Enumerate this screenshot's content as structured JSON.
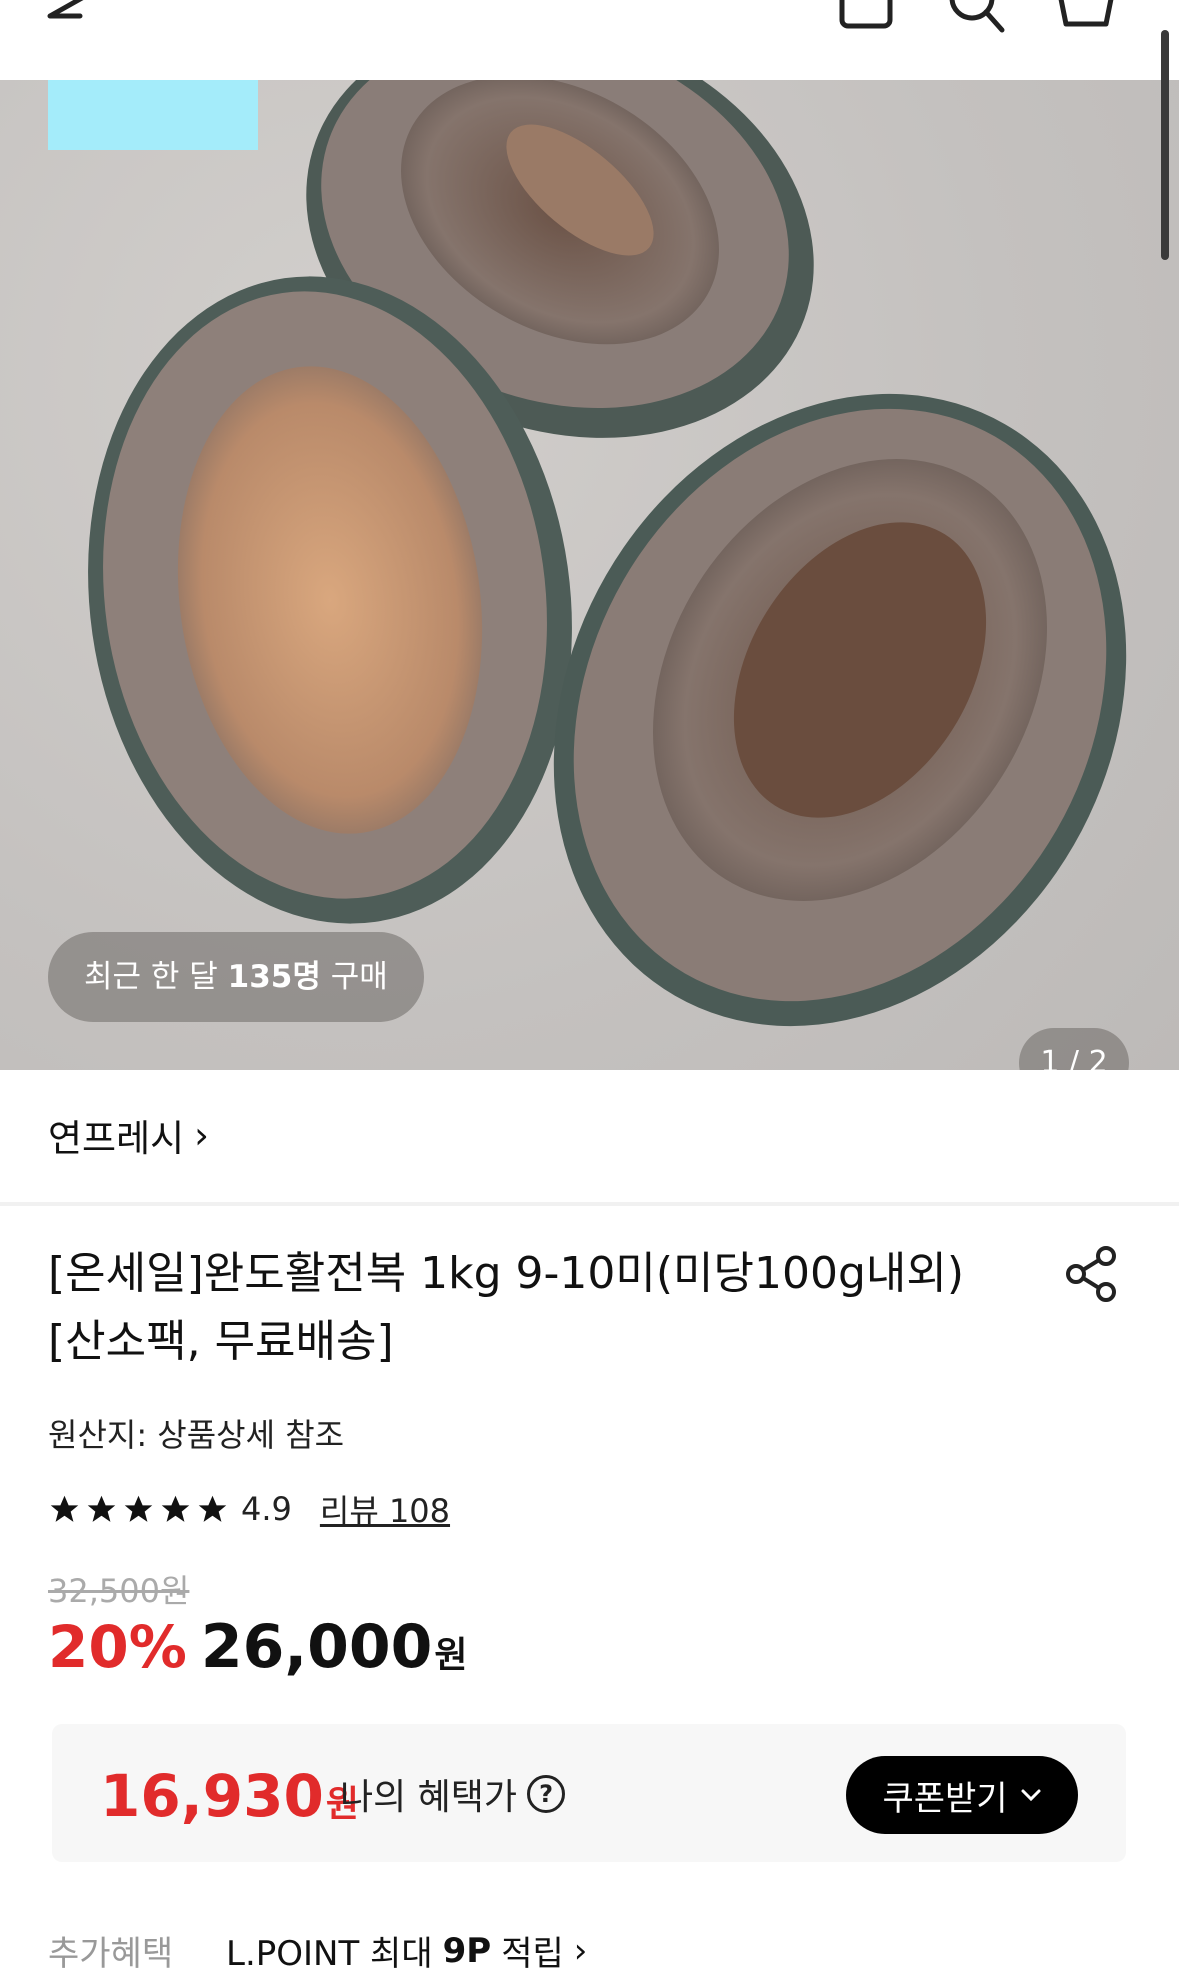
{
  "header": {
    "back_icon": "arrow-left-icon",
    "icons": [
      "shopping-bag-icon",
      "search-icon",
      "cart-icon"
    ]
  },
  "hero": {
    "buyers_prefix": "최근 한 달",
    "buyers_count": "135명",
    "buyers_suffix": "구매",
    "counter": "1 / 2",
    "badge_color": "#a4ecfa"
  },
  "store": {
    "name": "연프레시",
    "chevron": "›"
  },
  "product": {
    "title": "[온세일]완도활전복 1kg 9-10미(미당100g내외)[산소팩, 무료배송]",
    "origin": "원산지: 상품상세 참조",
    "rating": "4.9",
    "stars": 5,
    "review_link": "리뷰 108",
    "original_price": "32,500원",
    "discount": "20%",
    "price": "26,000",
    "price_unit": "원"
  },
  "benefit": {
    "price": "16,930",
    "unit": "원",
    "label": "나의 혜택가",
    "help": "?",
    "coupon_button": "쿠폰받기"
  },
  "extra": {
    "label": "추가혜택",
    "prefix": "L.POINT 최대",
    "points": "9P",
    "suffix": "적립",
    "chevron": "›"
  },
  "colors": {
    "accent_red": "#e12b2b",
    "coupon_bg": "#000000"
  }
}
